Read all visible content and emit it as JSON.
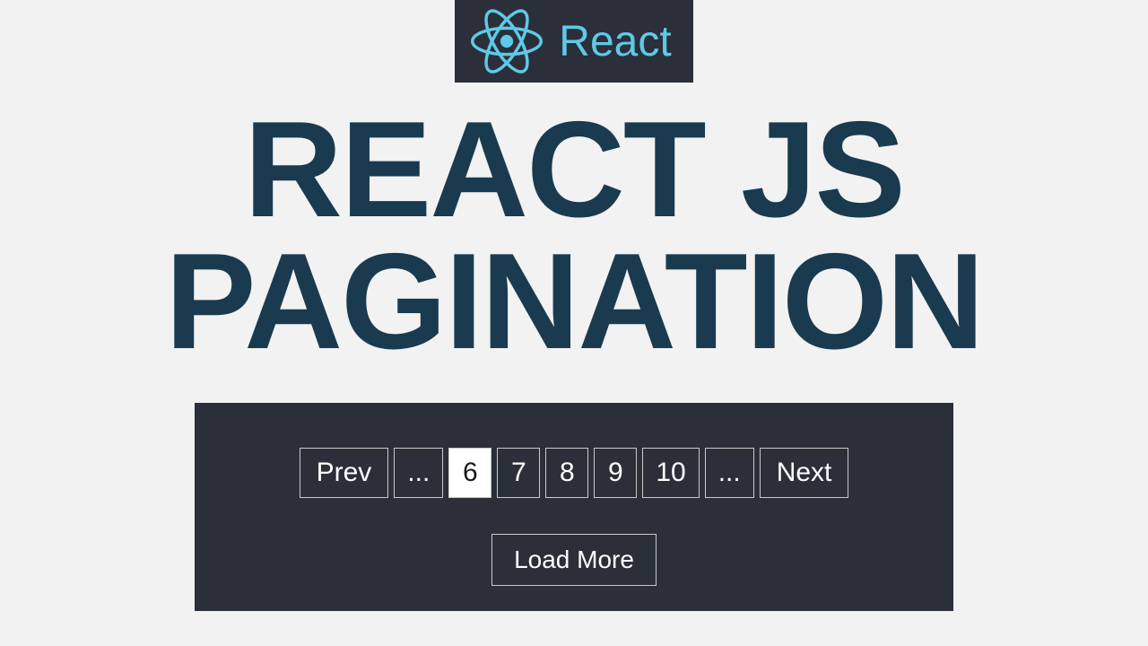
{
  "header": {
    "logo_icon": "react-icon",
    "logo_text": "React"
  },
  "title": {
    "line1": "REACT JS",
    "line2": "PAGINATION"
  },
  "pagination": {
    "prev_label": "Prev",
    "next_label": "Next",
    "ellipsis": "...",
    "pages": [
      "6",
      "7",
      "8",
      "9",
      "10"
    ],
    "active_page": "6",
    "load_more_label": "Load More"
  },
  "colors": {
    "react_blue": "#5fc9e7",
    "panel_bg": "#2a2f3a",
    "title_color": "#1a3a4f",
    "page_bg": "#f2f2f2"
  }
}
